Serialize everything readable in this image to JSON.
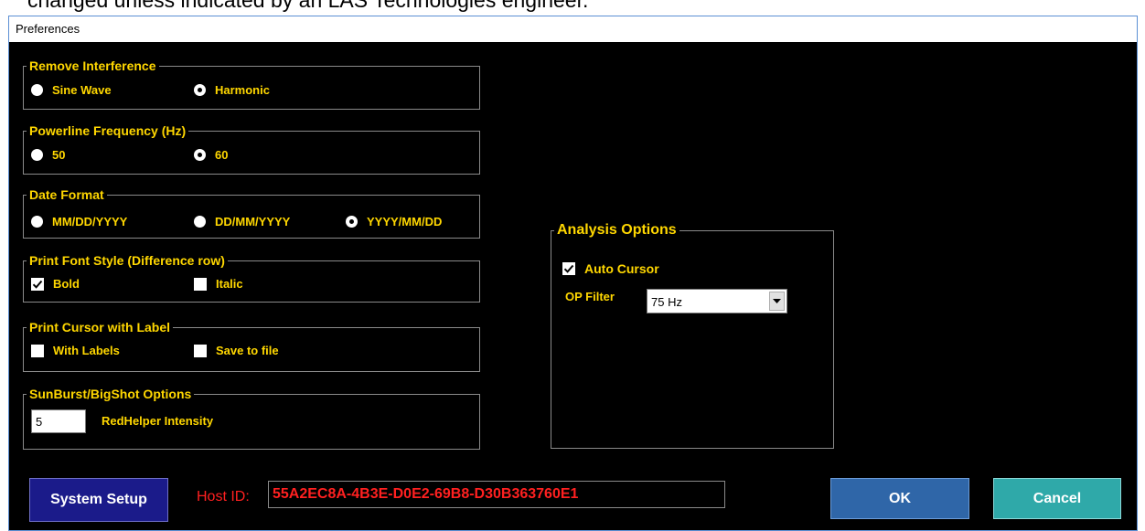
{
  "background_text": "changed unless indicated by an LAS Technologies engineer.",
  "window": {
    "title": "Preferences"
  },
  "remove_interference": {
    "legend": "Remove Interference",
    "options": [
      "Sine Wave",
      "Harmonic"
    ],
    "selected": "Harmonic"
  },
  "powerline_frequency": {
    "legend": "Powerline Frequency (Hz)",
    "options": [
      "50",
      "60"
    ],
    "selected": "60"
  },
  "date_format": {
    "legend": "Date Format",
    "options": [
      "MM/DD/YYYY",
      "DD/MM/YYYY",
      "YYYY/MM/DD"
    ],
    "selected": "YYYY/MM/DD"
  },
  "print_font_style": {
    "legend": "Print Font Style (Difference row)",
    "bold": {
      "label": "Bold",
      "checked": true
    },
    "italic": {
      "label": "Italic",
      "checked": false
    }
  },
  "print_cursor": {
    "legend": "Print Cursor with Label",
    "with_labels": {
      "label": "With Labels",
      "checked": false
    },
    "save_to_file": {
      "label": "Save to file",
      "checked": false
    }
  },
  "sunburst": {
    "legend": "SunBurst/BigShot Options",
    "intensity_value": "5",
    "intensity_label": "RedHelper Intensity"
  },
  "analysis": {
    "legend": "Analysis Options",
    "auto_cursor": {
      "label": "Auto Cursor",
      "checked": true
    },
    "op_filter_label": "OP Filter",
    "op_filter_value": "75 Hz"
  },
  "footer": {
    "system_setup": "System Setup",
    "host_id_label": "Host ID:",
    "host_id_value": "55A2EC8A-4B3E-D0E2-69B8-D30B363760E1",
    "ok": "OK",
    "cancel": "Cancel"
  },
  "colors": {
    "accent": "#ffd700",
    "host_id": "#ff2020",
    "ok_button": "#2f66a8",
    "cancel_button": "#2fa9a9",
    "system_setup_button": "#1b1b8a"
  }
}
